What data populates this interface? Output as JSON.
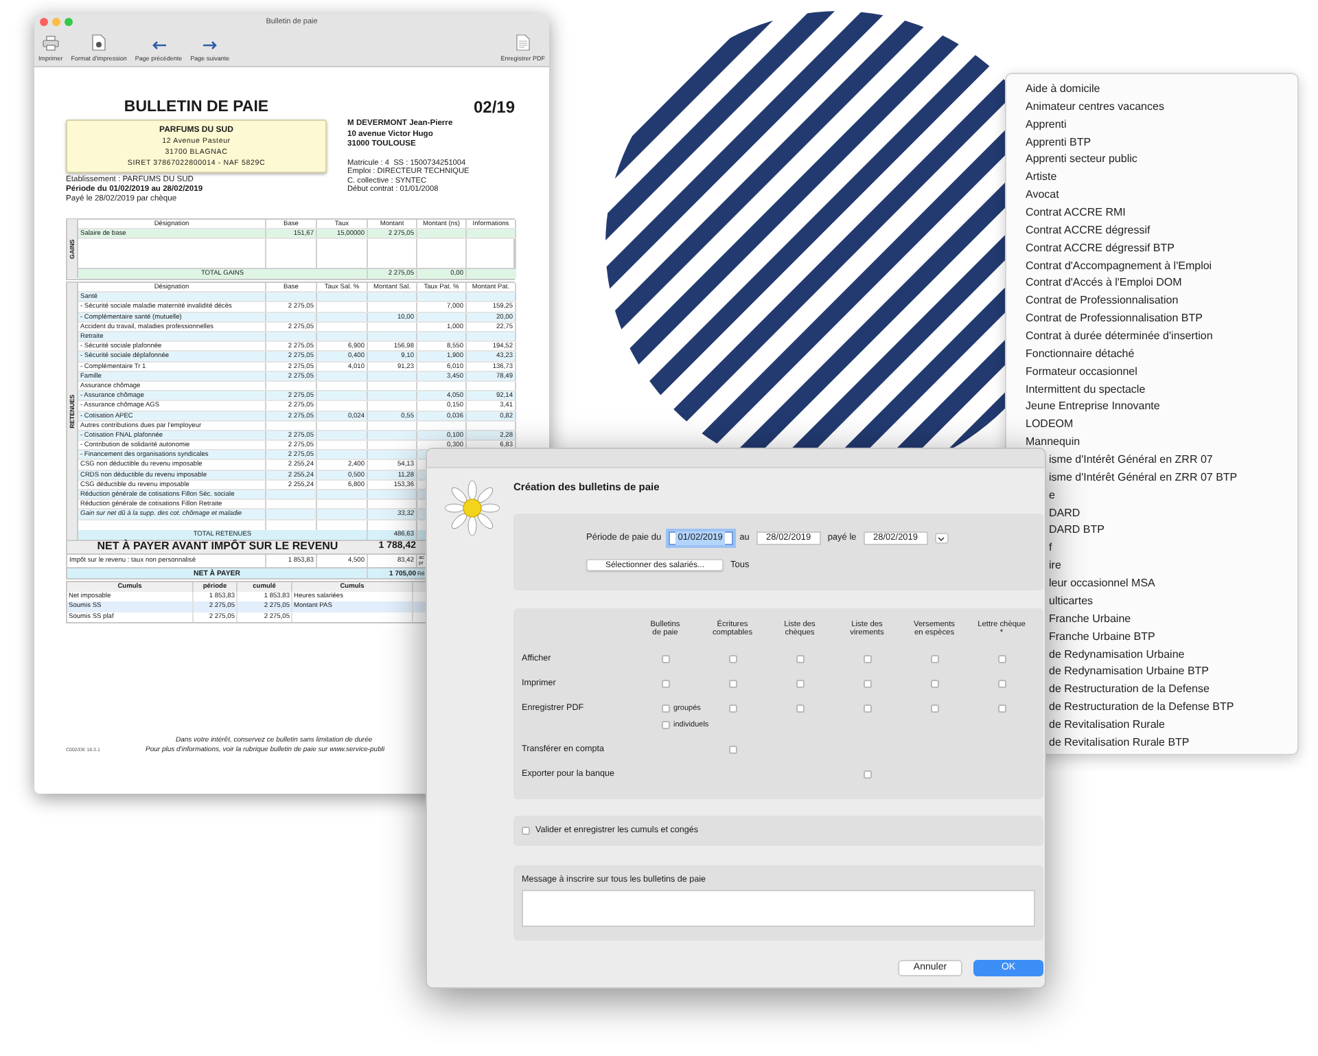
{
  "payslip_window": {
    "title": "Bulletin de paie",
    "toolbar_left": [
      {
        "kind": "print",
        "label": "Imprimer"
      },
      {
        "kind": "setup",
        "label": "Format d'impression"
      },
      {
        "kind": "prev",
        "label": "Page précédente"
      },
      {
        "kind": "next",
        "label": "Page suivante"
      }
    ],
    "toolbar_right": [
      {
        "kind": "pdf",
        "label": "Enregistrer PDF"
      }
    ],
    "document": {
      "title": "BULLETIN DE PAIE",
      "period_code": "02/19",
      "employer": {
        "name": "PARFUMS DU SUD",
        "lines": [
          "12 Avenue Pasteur",
          "31700 BLAGNAC",
          "SIRET 37867022800014 - NAF 5829C"
        ]
      },
      "employee": {
        "lines": [
          "M DEVERMONT Jean-Pierre",
          "10 avenue Victor Hugo",
          "31000 TOULOUSE"
        ],
        "details": [
          "Matricule : 4  SS : 1500734251004",
          "Emploi : DIRECTEUR TECHNIQUE",
          "C. collective : SYNTEC",
          "Début contrat : 01/01/2008"
        ]
      },
      "establishment": "Etablissement : PARFUMS DU SUD",
      "period": "Période du 01/02/2019 au 28/02/2019",
      "payment": "Payé le 28/02/2019 par chèque",
      "gains": {
        "side_label": "GAINS",
        "columns": [
          "Désignation",
          "Base",
          "Taux",
          "Montant",
          "Montant (ns)",
          "Informations"
        ],
        "rows": [
          [
            "Salaire de base",
            "151,67",
            "15,00000",
            "2 275,05"
          ]
        ],
        "total": {
          "label": "TOTAL GAINS",
          "values": [
            "2 275,05",
            "0,00"
          ]
        }
      },
      "retenues": {
        "side_label": "RETENUES",
        "columns": [
          "Désignation",
          "Base",
          "Taux Sal. %",
          "Montant Sal.",
          "Taux Pat. %",
          "Montant Pat."
        ],
        "rows": [
          {
            "kind": "line",
            "cells": [
              "Santé"
            ]
          },
          {
            "kind": "line",
            "cells": [
              "- Sécurité sociale maladie maternité invalidité décès",
              "2 275,05",
              null,
              null,
              "7,000",
              "159,25"
            ]
          },
          {
            "kind": "line",
            "cells": [
              "- Complémentaire santé (mutuelle)",
              null,
              null,
              "10,00",
              null,
              "20,00"
            ]
          },
          {
            "kind": "line",
            "cells": [
              "Accident du travail, maladies professionnelles",
              "2 275,05",
              null,
              null,
              "1,000",
              "22,75"
            ]
          },
          {
            "kind": "line",
            "cells": [
              "Retraite"
            ]
          },
          {
            "kind": "line",
            "cells": [
              "- Sécurité sociale plafonnée",
              "2 275,05",
              "6,900",
              "156,98",
              "8,550",
              "194,52"
            ]
          },
          {
            "kind": "line",
            "cells": [
              "- Sécurité sociale déplafonnée",
              "2 275,05",
              "0,400",
              "9,10",
              "1,900",
              "43,23"
            ]
          },
          {
            "kind": "line",
            "cells": [
              "- Complémentaire Tr 1",
              "2 275,05",
              "4,010",
              "91,23",
              "6,010",
              "136,73"
            ]
          },
          {
            "kind": "line",
            "cells": [
              "Famille",
              "2 275,05",
              null,
              null,
              "3,450",
              "78,49"
            ]
          },
          {
            "kind": "line",
            "cells": [
              "Assurance chômage"
            ]
          },
          {
            "kind": "line",
            "cells": [
              "- Assurance chômage",
              "2 275,05",
              null,
              null,
              "4,050",
              "92,14"
            ]
          },
          {
            "kind": "line",
            "cells": [
              "- Assurance chômage AGS",
              "2 275,05",
              null,
              null,
              "0,150",
              "3,41"
            ]
          },
          {
            "kind": "line",
            "cells": [
              "- Cotisation APEC",
              "2 275,05",
              "0,024",
              "0,55",
              "0,036",
              "0,82"
            ]
          },
          {
            "kind": "line",
            "cells": [
              "Autres contributions dues par l'employeur"
            ]
          },
          {
            "kind": "line",
            "cells": [
              "- Cotisation FNAL plafonnée",
              "2 275,05",
              null,
              null,
              "0,100",
              "2,28"
            ]
          },
          {
            "kind": "line",
            "cells": [
              "- Contribution de solidarité autonomie",
              "2 275,05",
              null,
              null,
              "0,300",
              "6,83"
            ]
          },
          {
            "kind": "line",
            "cells": [
              "- Financement des organisations syndicales",
              "2 275,05"
            ]
          },
          {
            "kind": "line",
            "cells": [
              "CSG non déductible du revenu imposable",
              "2 255,24",
              "2,400",
              "54,13"
            ]
          },
          {
            "kind": "line",
            "cells": [
              "CRDS non déductible du revenu imposable",
              "2 255,24",
              "0,500",
              "11,28"
            ]
          },
          {
            "kind": "line",
            "cells": [
              "CSG déductible du revenu imposable",
              "2 255,24",
              "6,800",
              "153,36"
            ]
          },
          {
            "kind": "line",
            "cells": [
              "Réduction générale de cotisations Fillon Séc. sociale"
            ]
          },
          {
            "kind": "line",
            "cells": [
              "Réduction générale de cotisations Fillon Retraite"
            ]
          },
          {
            "kind": "note",
            "cells": [
              "Gain sur net dû à la supp. des cot. chômage et maladie",
              null,
              null,
              "33,32"
            ]
          }
        ],
        "total": {
          "label": "TOTAL RETENUES",
          "value": "486,63"
        }
      },
      "net_before_tax": {
        "label": "NET À PAYER AVANT IMPÔT SUR LE REVENU",
        "amount": "1 788,42"
      },
      "tax": {
        "cells": [
          "Impôt sur le revenu : taux non personnalisé",
          "1 853,83",
          "4,500",
          "83,42"
        ],
        "side": [
          "ac",
          "pr"
        ]
      },
      "net": {
        "label": "NET À PAYER",
        "amount": "1 705,00",
        "side": "Ré"
      },
      "cumuls": {
        "columns": [
          "Cumuls",
          "période",
          "cumulé",
          "Cumuls"
        ],
        "rows": [
          [
            "Net imposable",
            "1 853,83",
            "1 853,83",
            "Heures salariées"
          ],
          [
            "Soumis SS",
            "2 275,05",
            "2 275,05",
            "Montant PAS"
          ],
          [
            "Soumis SS plaf",
            "2 275,05",
            "2 275,05",
            null
          ]
        ]
      },
      "footer_code": "C002/DE 18.3.1",
      "footer_lines": [
        "Dans votre intérêt, conservez ce bulletin sans limitation de durée",
        "Pour plus d'informations, voir la rubrique bulletin de paie sur www.service-publi"
      ]
    }
  },
  "contract_list": {
    "items": [
      {
        "kind": "full",
        "text": "Aide à domicile"
      },
      {
        "kind": "full",
        "text": "Animateur centres vacances"
      },
      {
        "kind": "full",
        "text": "Apprenti"
      },
      {
        "kind": "full",
        "text": "Apprenti BTP"
      },
      {
        "kind": "full",
        "text": "Apprenti secteur public"
      },
      {
        "kind": "full",
        "text": "Artiste"
      },
      {
        "kind": "full",
        "text": "Avocat"
      },
      {
        "kind": "full",
        "text": "Contrat ACCRE RMI"
      },
      {
        "kind": "full",
        "text": "Contrat ACCRE dégressif"
      },
      {
        "kind": "full",
        "text": "Contrat ACCRE dégressif BTP"
      },
      {
        "kind": "full",
        "text": "Contrat d'Accompagnement à l'Emploi"
      },
      {
        "kind": "full",
        "text": "Contrat d'Accés à l'Emploi DOM"
      },
      {
        "kind": "full",
        "text": "Contrat de Professionnalisation"
      },
      {
        "kind": "full",
        "text": "Contrat de Professionnalisation BTP"
      },
      {
        "kind": "full",
        "text": "Contrat à durée déterminée d'insertion"
      },
      {
        "kind": "full",
        "text": "Fonctionnaire détaché"
      },
      {
        "kind": "full",
        "text": "Formateur occasionnel"
      },
      {
        "kind": "full",
        "text": "Intermittent du spectacle"
      },
      {
        "kind": "full",
        "text": "Jeune Entreprise Innovante"
      },
      {
        "kind": "full",
        "text": "LODEOM"
      },
      {
        "kind": "full",
        "text": "Mannequin"
      },
      {
        "kind": "cut",
        "text": "isme d'Intérêt Général en ZRR 07"
      },
      {
        "kind": "cut",
        "text": "isme d'Intérêt Général en ZRR 07 BTP"
      },
      {
        "kind": "cut",
        "text": "e"
      },
      {
        "kind": "cut",
        "text": "DARD"
      },
      {
        "kind": "cut",
        "text": "DARD BTP"
      },
      {
        "kind": "cut",
        "text": "f"
      },
      {
        "kind": "cut",
        "text": "ire"
      },
      {
        "kind": "cut",
        "text": "leur occasionnel MSA"
      },
      {
        "kind": "cut",
        "text": "ulticartes"
      },
      {
        "kind": "cut",
        "text": "Franche Urbaine"
      },
      {
        "kind": "cut",
        "text": "Franche Urbaine BTP"
      },
      {
        "kind": "cut",
        "text": "de Redynamisation Urbaine"
      },
      {
        "kind": "cut",
        "text": "de Redynamisation Urbaine BTP"
      },
      {
        "kind": "cut",
        "text": "de Restructuration de la Defense"
      },
      {
        "kind": "cut",
        "text": "de Restructuration de la Defense BTP"
      },
      {
        "kind": "cut",
        "text": "de Revitalisation Rurale"
      },
      {
        "kind": "cut",
        "text": "de Revitalisation Rurale BTP"
      }
    ]
  },
  "dialog": {
    "title": "Création des bulletins de paie",
    "period": {
      "items": [
        {
          "kind": "label",
          "text": "Période de paie du"
        },
        {
          "kind": "date",
          "value": "01/02/2019",
          "focused": true
        },
        {
          "kind": "label",
          "text": "au"
        },
        {
          "kind": "date",
          "value": "28/02/2019",
          "focused": false
        },
        {
          "kind": "label",
          "text": "payé le"
        },
        {
          "kind": "date",
          "value": "28/02/2019",
          "focused": false
        },
        {
          "kind": "menu"
        }
      ]
    },
    "employees": {
      "button": "Sélectionner des salariés...",
      "value": "Tous"
    },
    "outputs": {
      "columns": [
        {
          "lines": [
            "Bulletins",
            "de paie"
          ]
        },
        {
          "lines": [
            "Écritures",
            "comptables"
          ]
        },
        {
          "lines": [
            "Liste des",
            "chèques"
          ]
        },
        {
          "lines": [
            "Liste des",
            "virements"
          ]
        },
        {
          "lines": [
            "Versements",
            "en espèces"
          ]
        },
        {
          "lines": [
            "Lettre chèque",
            "*"
          ]
        }
      ],
      "rows": [
        {
          "label": "Afficher",
          "cells": [
            {
              "kind": "box",
              "checked": false
            },
            {
              "kind": "box",
              "checked": false
            },
            {
              "kind": "box",
              "checked": false
            },
            {
              "kind": "box",
              "checked": false
            },
            {
              "kind": "box",
              "checked": false
            },
            {
              "kind": "box",
              "checked": false
            }
          ]
        },
        {
          "label": "Imprimer",
          "cells": [
            {
              "kind": "box",
              "checked": false
            },
            {
              "kind": "box",
              "checked": false
            },
            {
              "kind": "box",
              "checked": false
            },
            {
              "kind": "box",
              "checked": false
            },
            {
              "kind": "box",
              "checked": false
            },
            {
              "kind": "box",
              "checked": false
            }
          ]
        },
        {
          "label": "Enregistrer PDF",
          "cells": [
            {
              "kind": "options",
              "options": [
                {
                  "label": "groupés",
                  "checked": false
                },
                {
                  "label": "individuels",
                  "checked": false
                }
              ]
            },
            {
              "kind": "box",
              "checked": false
            },
            {
              "kind": "box",
              "checked": false
            },
            {
              "kind": "box",
              "checked": false
            },
            {
              "kind": "box",
              "checked": false
            },
            {
              "kind": "box",
              "checked": false
            }
          ]
        },
        {
          "label": "Transférer en compta",
          "cells": [
            {
              "kind": "none"
            },
            {
              "kind": "box",
              "checked": false
            },
            {
              "kind": "none"
            },
            {
              "kind": "none"
            },
            {
              "kind": "none"
            },
            {
              "kind": "none"
            }
          ]
        },
        {
          "label": "Exporter pour la banque",
          "cells": [
            {
              "kind": "none"
            },
            {
              "kind": "none"
            },
            {
              "kind": "none"
            },
            {
              "kind": "box",
              "checked": false
            },
            {
              "kind": "none"
            },
            {
              "kind": "none"
            }
          ]
        }
      ]
    },
    "validate": {
      "label": "Valider et enregistrer les cumuls et congés",
      "checked": false
    },
    "message": {
      "label": "Message à inscrire sur tous les bulletins de paie"
    },
    "buttons": [
      {
        "label": "Annuler",
        "default": false
      },
      {
        "label": "OK",
        "default": true
      }
    ]
  }
}
